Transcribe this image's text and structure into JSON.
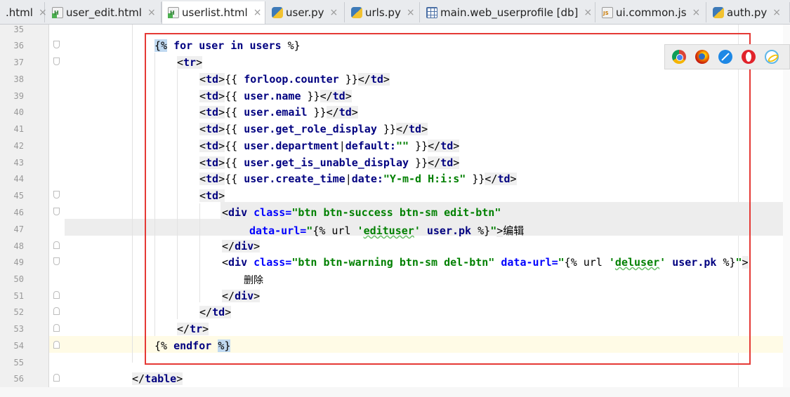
{
  "tabs": [
    {
      "label": ".html",
      "icon": "html-file-icon",
      "active": false
    },
    {
      "label": "user_edit.html",
      "icon": "html-file-icon",
      "active": false
    },
    {
      "label": "userlist.html",
      "icon": "html-file-icon",
      "active": true
    },
    {
      "label": "user.py",
      "icon": "python-file-icon",
      "active": false
    },
    {
      "label": "urls.py",
      "icon": "python-file-icon",
      "active": false
    },
    {
      "label": "main.web_userprofile [db]",
      "icon": "db-table-icon",
      "active": false
    },
    {
      "label": "ui.common.js",
      "icon": "js-file-icon",
      "active": false
    },
    {
      "label": "auth.py",
      "icon": "python-file-icon",
      "active": false
    }
  ],
  "close_glyph": "×",
  "line_numbers": [
    "35",
    "36",
    "37",
    "38",
    "39",
    "40",
    "41",
    "42",
    "43",
    "44",
    "45",
    "46",
    "47",
    "48",
    "49",
    "50",
    "51",
    "52",
    "53",
    "54",
    "55",
    "56"
  ],
  "code": {
    "l36": {
      "a": "{%",
      "b": " for ",
      "c": "user",
      "d": " in ",
      "e": "users",
      "f": " %}"
    },
    "l37": {
      "a": "<",
      "b": "tr",
      "c": ">"
    },
    "l38": {
      "a": "<",
      "b": "td",
      "c": ">",
      "d": "{{ ",
      "e": "forloop.counter",
      "f": " }}",
      "g": "</",
      "h": "td",
      "i": ">"
    },
    "l39": {
      "a": "<",
      "b": "td",
      "c": ">",
      "d": "{{ ",
      "e": "user.name",
      "f": " }}",
      "g": "</",
      "h": "td",
      "i": ">"
    },
    "l40": {
      "a": "<",
      "b": "td",
      "c": ">",
      "d": "{{ ",
      "e": "user.email",
      "f": " }}",
      "g": "</",
      "h": "td",
      "i": ">"
    },
    "l41": {
      "a": "<",
      "b": "td",
      "c": ">",
      "d": "{{ ",
      "e": "user.get_role_display",
      "f": " }}",
      "g": "</",
      "h": "td",
      "i": ">"
    },
    "l42": {
      "a": "<",
      "b": "td",
      "c": ">",
      "d": "{{ ",
      "e": "user.department",
      "f": "|",
      "g": "default:",
      "h": "\"\"",
      "i": " }}",
      "j": "</",
      "k": "td",
      "l": ">"
    },
    "l43": {
      "a": "<",
      "b": "td",
      "c": ">",
      "d": "{{ ",
      "e": "user.get_is_unable_display",
      "f": " }}",
      "g": "</",
      "h": "td",
      "i": ">"
    },
    "l44": {
      "a": "<",
      "b": "td",
      "c": ">",
      "d": "{{ ",
      "e": "user.create_time",
      "f": "|",
      "g": "date:",
      "h": "\"Y-m-d H:i:s\"",
      "i": " }}",
      "j": "</",
      "k": "td",
      "l": ">"
    },
    "l45": {
      "a": "<",
      "b": "td",
      "c": ">"
    },
    "l46": {
      "a": "<",
      "b": "div",
      "c": " class=",
      "d": "\"btn btn-success btn-sm edit-btn\""
    },
    "l47": {
      "a": "data-url=",
      "b": "\"",
      "c": "{% url ",
      "d": "'",
      "e": "edituser",
      "f": "'",
      "g": " user.pk ",
      "h": "%}",
      "i": "\"",
      "j": ">",
      "k": "编辑"
    },
    "l48": {
      "a": "</",
      "b": "div",
      "c": ">"
    },
    "l49": {
      "a": "<",
      "b": "div",
      "c": " class=",
      "d": "\"btn btn-warning btn-sm del-btn\"",
      "e": " data-url=",
      "f": "\"",
      "g": "{% url ",
      "h": "'",
      "i": "deluser",
      "j": "'",
      "k": " user.pk ",
      "l": "%}",
      "m": "\"",
      "n": ">"
    },
    "l50": {
      "a": "删除"
    },
    "l51": {
      "a": "</",
      "b": "div",
      "c": ">"
    },
    "l52": {
      "a": "</",
      "b": "td",
      "c": ">"
    },
    "l53": {
      "a": "</",
      "b": "tr",
      "c": ">"
    },
    "l54": {
      "a": "{%",
      "b": " endfor ",
      "c": "%}"
    },
    "l56": {
      "a": "</",
      "b": "table",
      "c": ">"
    }
  },
  "browsers": [
    "chrome-icon",
    "firefox-icon",
    "safari-icon",
    "opera-icon",
    "ie-icon"
  ],
  "colors": {
    "highlight_box": "#e53935",
    "tag": "#000080",
    "attribute": "#0000ff",
    "string": "#008000",
    "caret_line": "#fffbe6"
  }
}
